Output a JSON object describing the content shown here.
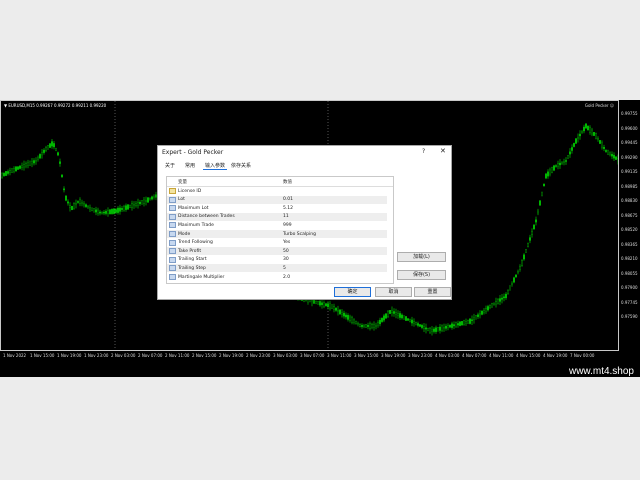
{
  "chart": {
    "symbol_info": "▼ EURUSD,M15  0.99267 0.99272 0.99211 0.99220",
    "ea_label": "Gold Pecker ☺",
    "price_ticks": [
      "0.99755",
      "0.99600",
      "0.99445",
      "0.99290",
      "0.99135",
      "0.98985",
      "0.98830",
      "0.98675",
      "0.98520",
      "0.98365",
      "0.98210",
      "0.98055",
      "0.97900",
      "0.97745",
      "0.97590"
    ],
    "time_ticks": [
      "1 Nov 2022",
      "1 Nov 15:00",
      "1 Nov 19:00",
      "1 Nov 23:00",
      "2 Nov 03:00",
      "2 Nov 07:00",
      "2 Nov 11:00",
      "2 Nov 15:00",
      "2 Nov 19:00",
      "2 Nov 23:00",
      "3 Nov 03:00",
      "3 Nov 07:00",
      "3 Nov 11:00",
      "3 Nov 15:00",
      "3 Nov 19:00",
      "3 Nov 23:00",
      "4 Nov 03:00",
      "4 Nov 07:00",
      "4 Nov 11:00",
      "4 Nov 15:00",
      "4 Nov 19:00",
      "7 Nov 00:00"
    ],
    "candle_color": "#00e400",
    "background": "#000000"
  },
  "watermark": "www.mt4.shop",
  "dialog": {
    "title": "Expert - Gold Pecker",
    "help": "?",
    "close": "✕",
    "tabs": [
      "关于",
      "常用",
      "输入参数",
      "依存关系"
    ],
    "active_tab": "输入参数",
    "col_variable": "变量",
    "col_value": "数值",
    "params": [
      {
        "name": "License ID",
        "value": ""
      },
      {
        "name": "Lot",
        "value": "0.01"
      },
      {
        "name": "Maximum Lot",
        "value": "5.12"
      },
      {
        "name": "Distance between Trades",
        "value": "11"
      },
      {
        "name": "Maximum Trade",
        "value": "999"
      },
      {
        "name": "Mode",
        "value": "Turbo Scalping"
      },
      {
        "name": "Trend Following",
        "value": "Yes"
      },
      {
        "name": "Take Profit",
        "value": "50"
      },
      {
        "name": "Trailing Start",
        "value": "30"
      },
      {
        "name": "Trailing Step",
        "value": "5"
      },
      {
        "name": "Martingale Multiplier",
        "value": "2.0"
      }
    ],
    "btn_load": "加载(L)",
    "btn_save": "保存(S)",
    "btn_ok": "确定",
    "btn_cancel": "取消",
    "btn_reset": "重置"
  }
}
